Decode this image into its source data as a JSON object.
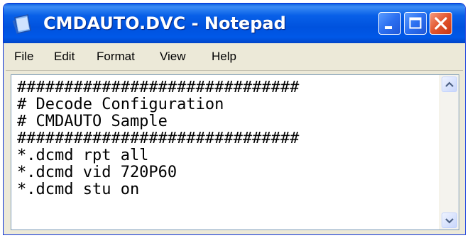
{
  "window": {
    "title": "CMDAUTO.DVC - Notepad",
    "app_icon": "notepad-icon",
    "controls": {
      "minimize": "minimize-icon",
      "maximize": "maximize-icon",
      "close": "close-icon"
    }
  },
  "menu": {
    "items": [
      "File",
      "Edit",
      "Format",
      "View",
      "Help"
    ]
  },
  "editor": {
    "lines": [
      "##############################",
      "# Decode Configuration",
      "# CMDAUTO Sample",
      "##############################",
      "*.dcmd rpt all",
      "*.dcmd vid 720P60",
      "*.dcmd stu on"
    ]
  },
  "colors": {
    "titlebar": "#0054e3",
    "window_face": "#ece9d8",
    "close_button": "#e2542c"
  }
}
